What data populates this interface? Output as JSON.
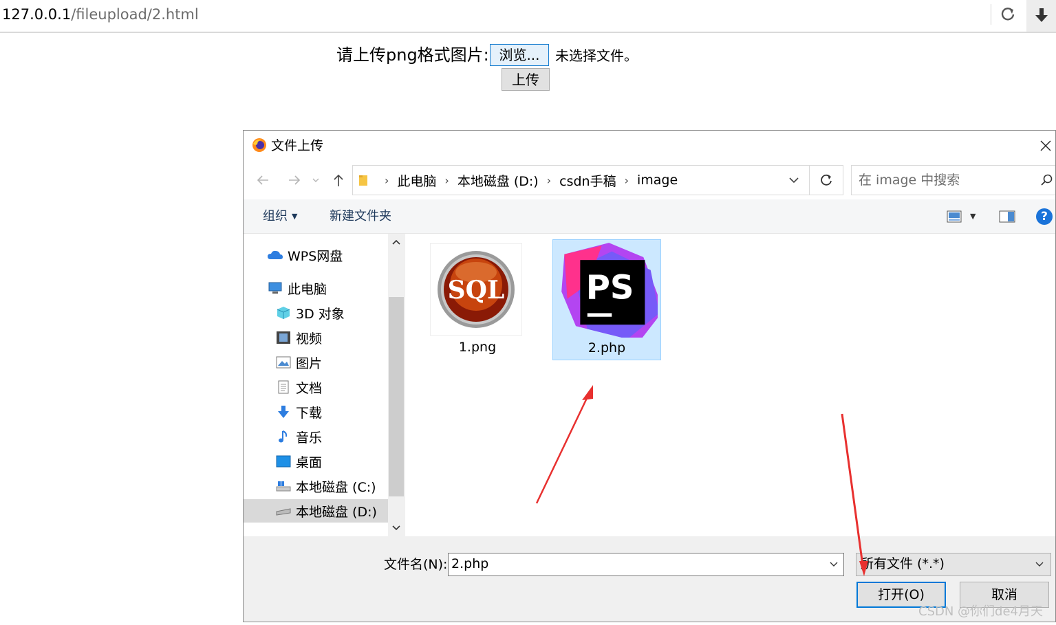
{
  "browser": {
    "url_host": "127.0.0.1",
    "url_path": "/fileupload/2.html"
  },
  "form": {
    "label": "请上传png格式图片:",
    "browse_label": "浏览...",
    "no_file_text": "未选择文件。",
    "submit_label": "上传"
  },
  "dialog": {
    "title": "文件上传",
    "breadcrumbs": [
      "此电脑",
      "本地磁盘 (D:)",
      "csdn手稿",
      "image"
    ],
    "search_placeholder": "在 image 中搜索",
    "toolbar": {
      "organize_label": "组织",
      "new_folder_label": "新建文件夹"
    },
    "nav_items": [
      {
        "label": "WPS网盘",
        "icon": "cloud-icon"
      },
      {
        "label": "此电脑",
        "icon": "computer-icon"
      },
      {
        "label": "3D 对象",
        "icon": "3d-objects-icon"
      },
      {
        "label": "视频",
        "icon": "video-icon"
      },
      {
        "label": "图片",
        "icon": "pictures-icon"
      },
      {
        "label": "文档",
        "icon": "documents-icon"
      },
      {
        "label": "下载",
        "icon": "download-icon"
      },
      {
        "label": "音乐",
        "icon": "music-icon"
      },
      {
        "label": "桌面",
        "icon": "desktop-icon"
      },
      {
        "label": "本地磁盘 (C:)",
        "icon": "drive-c-icon"
      },
      {
        "label": "本地磁盘 (D:)",
        "icon": "drive-d-icon"
      }
    ],
    "files": [
      {
        "name": "1.png",
        "thumb_text": "SQL"
      },
      {
        "name": "2.php",
        "thumb_text": "PS"
      }
    ],
    "filename_label": "文件名(N):",
    "filename_value": "2.php",
    "filetype_value": "所有文件 (*.*)",
    "open_label": "打开(O)",
    "cancel_label": "取消"
  },
  "watermark": "CSDN @你们de4月天",
  "colors": {
    "accent_blue": "#0078d7",
    "selection": "#cce8ff",
    "arrow_red": "#e8302f"
  }
}
